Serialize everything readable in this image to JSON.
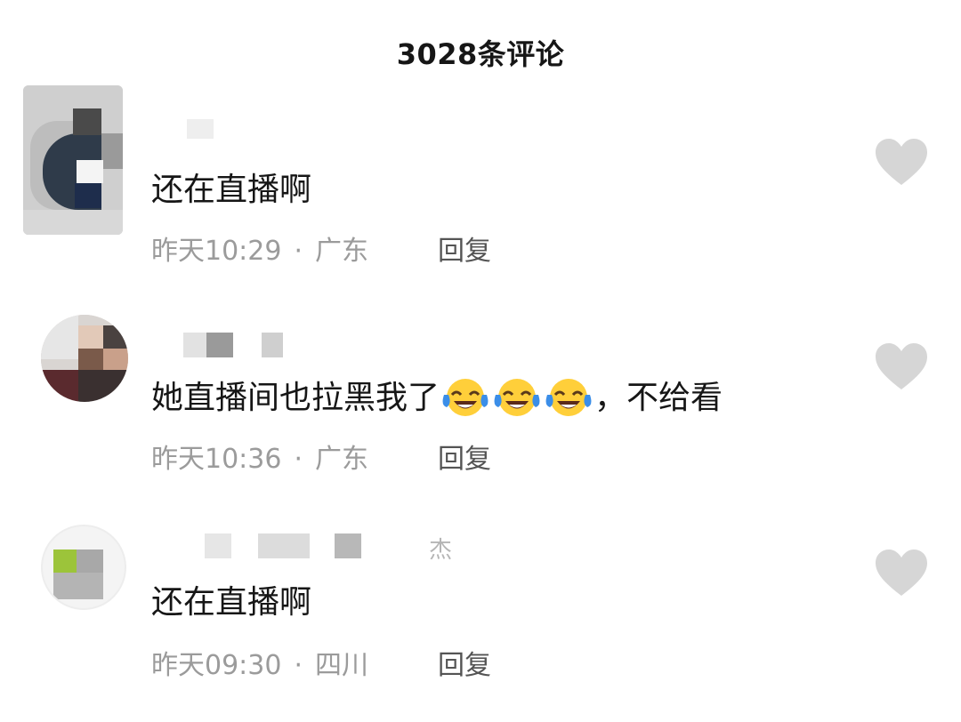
{
  "header": {
    "title": "3028条评论"
  },
  "comments": [
    {
      "text": "还在直播啊",
      "time": "昨天10:29",
      "location": "广东",
      "reply_label": "回复",
      "username_visible": ""
    },
    {
      "text_before": "她直播间也拉黑我了",
      "emoji": [
        "face-with-tears-of-joy",
        "face-with-tears-of-joy",
        "face-with-tears-of-joy"
      ],
      "text_after": "，不给看",
      "time": "昨天10:36",
      "location": "广东",
      "reply_label": "回复"
    },
    {
      "text": "还在直播啊",
      "time": "昨天09:30",
      "location": "四川",
      "reply_label": "回复",
      "username_visible": "杰"
    }
  ],
  "meta_separator": "·",
  "colors": {
    "text": "#161616",
    "meta": "#9b9b9b",
    "reply": "#545454",
    "heart": "#d6d6d6",
    "emoji_face": "#ffcf3a",
    "emoji_tear": "#3b8ee8"
  }
}
